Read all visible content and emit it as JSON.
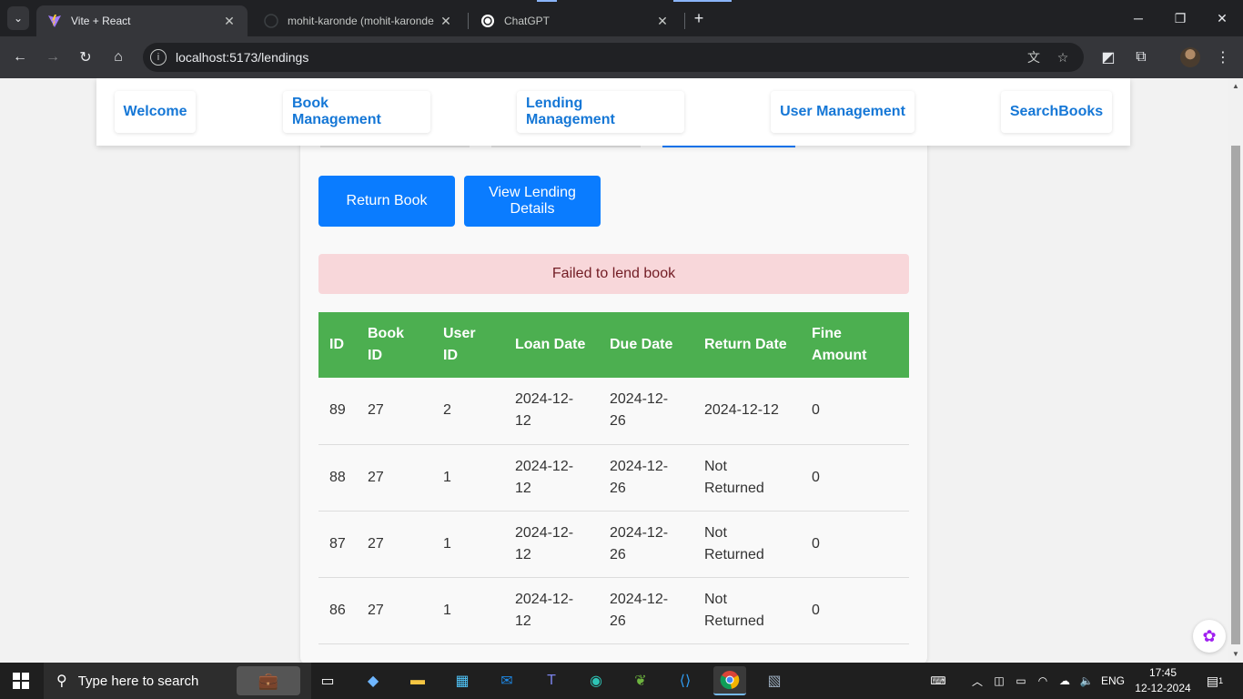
{
  "browser": {
    "tabs": [
      {
        "title": "Vite + React",
        "active": true,
        "favicon": "vite-icon"
      },
      {
        "title": "mohit-karonde (mohit-karonde",
        "active": false,
        "favicon": "github-icon"
      },
      {
        "title": "ChatGPT",
        "active": false,
        "favicon": "chatgpt-icon"
      }
    ],
    "url": "localhost:5173/lendings"
  },
  "nav": {
    "welcome": "Welcome",
    "book_management": "Book Management",
    "lending_management": "Lending Management",
    "user_management": "User Management",
    "search_books": "SearchBooks"
  },
  "actions": {
    "return_book": "Return Book",
    "view_lending_details": "View Lending Details"
  },
  "alert": {
    "message": "Failed to lend book",
    "color": "#f8d7da"
  },
  "table": {
    "headers": [
      "ID",
      "Book ID",
      "User ID",
      "Loan Date",
      "Due Date",
      "Return Date",
      "Fine Amount"
    ],
    "header_color": "#4caf50",
    "rows": [
      [
        "89",
        "27",
        "2",
        "2024-12-12",
        "2024-12-26",
        "2024-12-12",
        "0"
      ],
      [
        "88",
        "27",
        "1",
        "2024-12-12",
        "2024-12-26",
        "Not Returned",
        "0"
      ],
      [
        "87",
        "27",
        "1",
        "2024-12-12",
        "2024-12-26",
        "Not Returned",
        "0"
      ],
      [
        "86",
        "27",
        "1",
        "2024-12-12",
        "2024-12-26",
        "Not Returned",
        "0"
      ]
    ]
  },
  "taskbar": {
    "search_placeholder": "Type here to search",
    "language": "ENG",
    "time": "17:45",
    "date": "12-12-2024",
    "notification_count": "1"
  },
  "colors": {
    "accent_button": "#0a7cff",
    "nav_link": "#1577d6"
  }
}
